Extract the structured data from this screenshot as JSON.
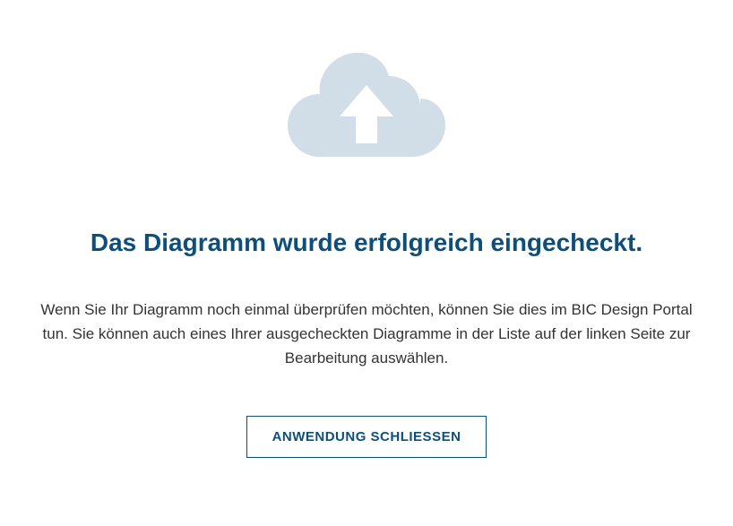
{
  "icon": {
    "name": "cloud-upload-icon",
    "fill_color": "#d1dde7",
    "arrow_color": "#ffffff"
  },
  "heading": "Das Diagramm wurde erfolgreich eingecheckt.",
  "description": "Wenn Sie Ihr Diagramm noch einmal überprüfen möchten, können Sie dies im BIC Design Portal tun. Sie können auch eines Ihrer ausgecheckten Diagramme in der Liste auf der linken Seite zur Bearbeitung auswählen.",
  "button": {
    "close_label": "ANWENDUNG SCHLIESSEN"
  },
  "colors": {
    "primary": "#0d4f7a",
    "text": "#333333",
    "icon_fill": "#d1dde7"
  }
}
